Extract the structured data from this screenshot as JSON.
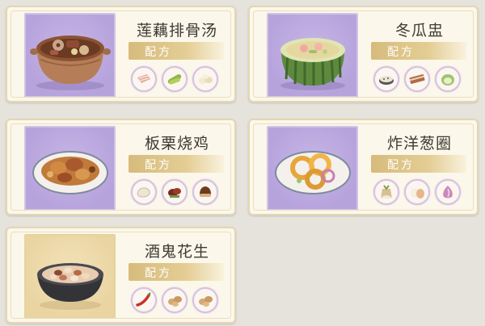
{
  "recipe_label": "配方",
  "cards": [
    {
      "name": "莲藕排骨汤",
      "thumb_bg": "purple",
      "icon": "lotus-rib-soup-icon",
      "ingredients": [
        "pork-rib-icon",
        "cucumber-icon",
        "garlic-icon"
      ]
    },
    {
      "name": "冬瓜盅",
      "thumb_bg": "purple",
      "icon": "winter-melon-bowl-icon",
      "ingredients": [
        "sesame-icon",
        "bacon-icon",
        "green-vegetable-icon"
      ]
    },
    {
      "name": "板栗烧鸡",
      "thumb_bg": "purple",
      "icon": "chestnut-chicken-icon",
      "ingredients": [
        "chicken-icon",
        "red-dates-icon",
        "chestnut-icon"
      ]
    },
    {
      "name": "炸洋葱圈",
      "thumb_bg": "purple",
      "icon": "onion-rings-icon",
      "ingredients": [
        "flour-icon",
        "egg-icon",
        "onion-icon"
      ]
    },
    {
      "name": "酒鬼花生",
      "thumb_bg": "gold",
      "icon": "drunken-peanuts-icon",
      "ingredients": [
        "chili-icon",
        "peanut-icon",
        "peanut-icon"
      ]
    }
  ]
}
